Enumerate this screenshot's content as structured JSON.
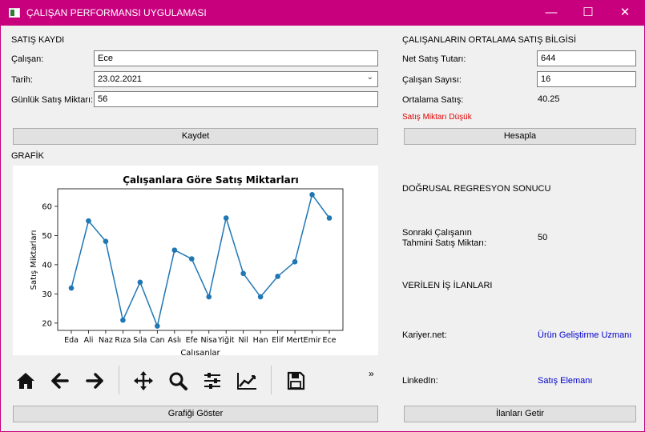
{
  "window": {
    "title": "ÇALIŞAN PERFORMANSI UYGULAMASI",
    "controls": {
      "minimize": "—",
      "maximize": "☐",
      "close": "✕"
    }
  },
  "sales_record": {
    "heading": "SATIŞ KAYDI",
    "employee_label": "Çalışan:",
    "employee_value": "Ece",
    "date_label": "Tarih:",
    "date_value": "23.02.2021",
    "daily_sales_label": "Günlük Satış Miktarı:",
    "daily_sales_value": "56",
    "save_button": "Kaydet"
  },
  "average": {
    "heading": "ÇALIŞANLARIN ORTALAMA SATIŞ BİLGİSİ",
    "net_sales_label": "Net Satış Tutarı:",
    "net_sales_value": "644",
    "employee_count_label": "Çalışan Sayısı:",
    "employee_count_value": "16",
    "avg_sales_label": "Ortalama Satış:",
    "avg_sales_value": "40.25",
    "warning": "Satış Miktarı Düşük",
    "calc_button": "Hesapla"
  },
  "chart_section": {
    "heading": "GRAFİK",
    "show_button": "Grafiği Göster",
    "overflow": "»"
  },
  "chart_data": {
    "type": "line",
    "title": "Çalışanlara Göre Satış Miktarları",
    "xlabel": "Calısanlar",
    "ylabel": "Satış Miktarları",
    "categories": [
      "Eda",
      "Ali",
      "Naz",
      "Rıza",
      "Sıla",
      "Can",
      "Aslı",
      "Efe",
      "Nisa",
      "Yiğit",
      "Nil",
      "Han",
      "Elif",
      "Mert",
      "Emir",
      "Ece"
    ],
    "values": [
      32,
      55,
      48,
      21,
      34,
      19,
      45,
      42,
      29,
      56,
      37,
      29,
      36,
      41,
      64,
      56
    ],
    "ylim": [
      17.5,
      66
    ],
    "yticks": [
      20,
      30,
      40,
      50,
      60
    ],
    "grid": false,
    "color": "#1f77b4"
  },
  "regression": {
    "heading": "DOĞRUSAL REGRESYON SONUCU",
    "next_label_line1": "Sonraki Çalışanın",
    "next_label_line2": "Tahmini Satış Miktarı:",
    "next_value": "50"
  },
  "jobs": {
    "heading": "VERİLEN İŞ İLANLARI",
    "kariyer_label": "Kariyer.net:",
    "kariyer_value": "Ürün Geliştirme Uzmanı",
    "linkedin_label": "LinkedIn:",
    "linkedin_value": "Satış Elemanı",
    "fetch_button": "İlanları Getir"
  },
  "colors": {
    "titlebar": "#c8007e",
    "warning": "#e00000",
    "link": "#0000cc"
  }
}
